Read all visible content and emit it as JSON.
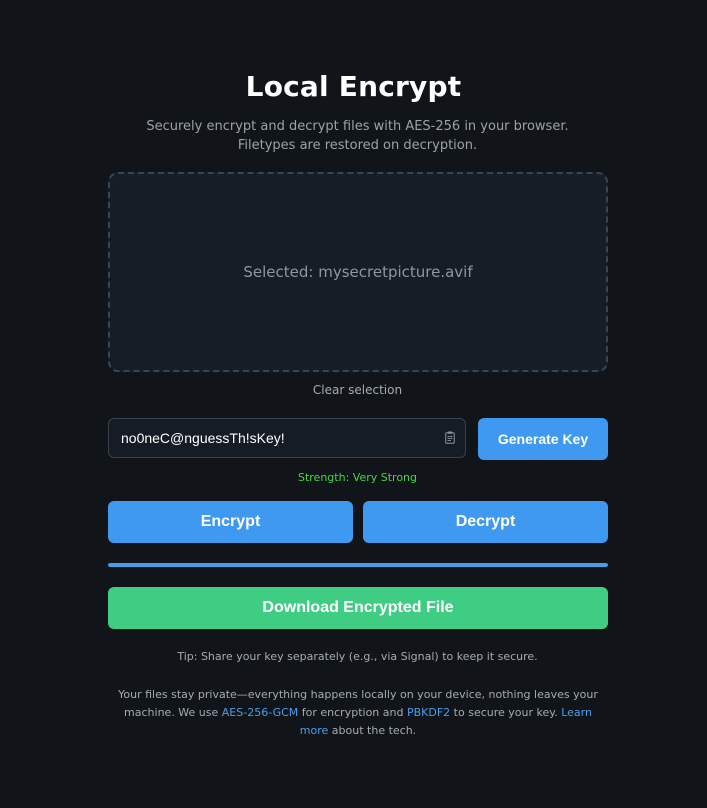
{
  "header": {
    "title": "Local Encrypt",
    "subtitle_line1": "Securely encrypt and decrypt files with AES-256 in your browser.",
    "subtitle_line2": "Filetypes are restored on decryption."
  },
  "dropzone": {
    "text": "Selected: mysecretpicture.avif"
  },
  "clear_selection_label": "Clear selection",
  "key": {
    "value": "no0neC@nguessTh!sKey!",
    "placeholder": "",
    "clipboard_icon": "clipboard-icon"
  },
  "buttons": {
    "generate_key": "Generate Key",
    "encrypt": "Encrypt",
    "decrypt": "Decrypt",
    "download": "Download Encrypted File"
  },
  "strength_text": "Strength: Very Strong",
  "progress": {
    "percent": 100
  },
  "tip": "Tip: Share your key separately (e.g., via Signal) to keep it secure.",
  "footer": {
    "text1": "Your files stay private—everything happens locally on your device, nothing leaves your machine. We use ",
    "link1": "AES-256-GCM",
    "text2": " for encryption and ",
    "link2": "PBKDF2",
    "text3": " to secure your key. ",
    "link3": "Learn more",
    "text4": " about the tech."
  },
  "colors": {
    "background": "#111418",
    "primary_button": "#3f99f0",
    "download_button": "#3fcd84",
    "strength_text": "#4ad44a",
    "link": "#4b9fef"
  }
}
